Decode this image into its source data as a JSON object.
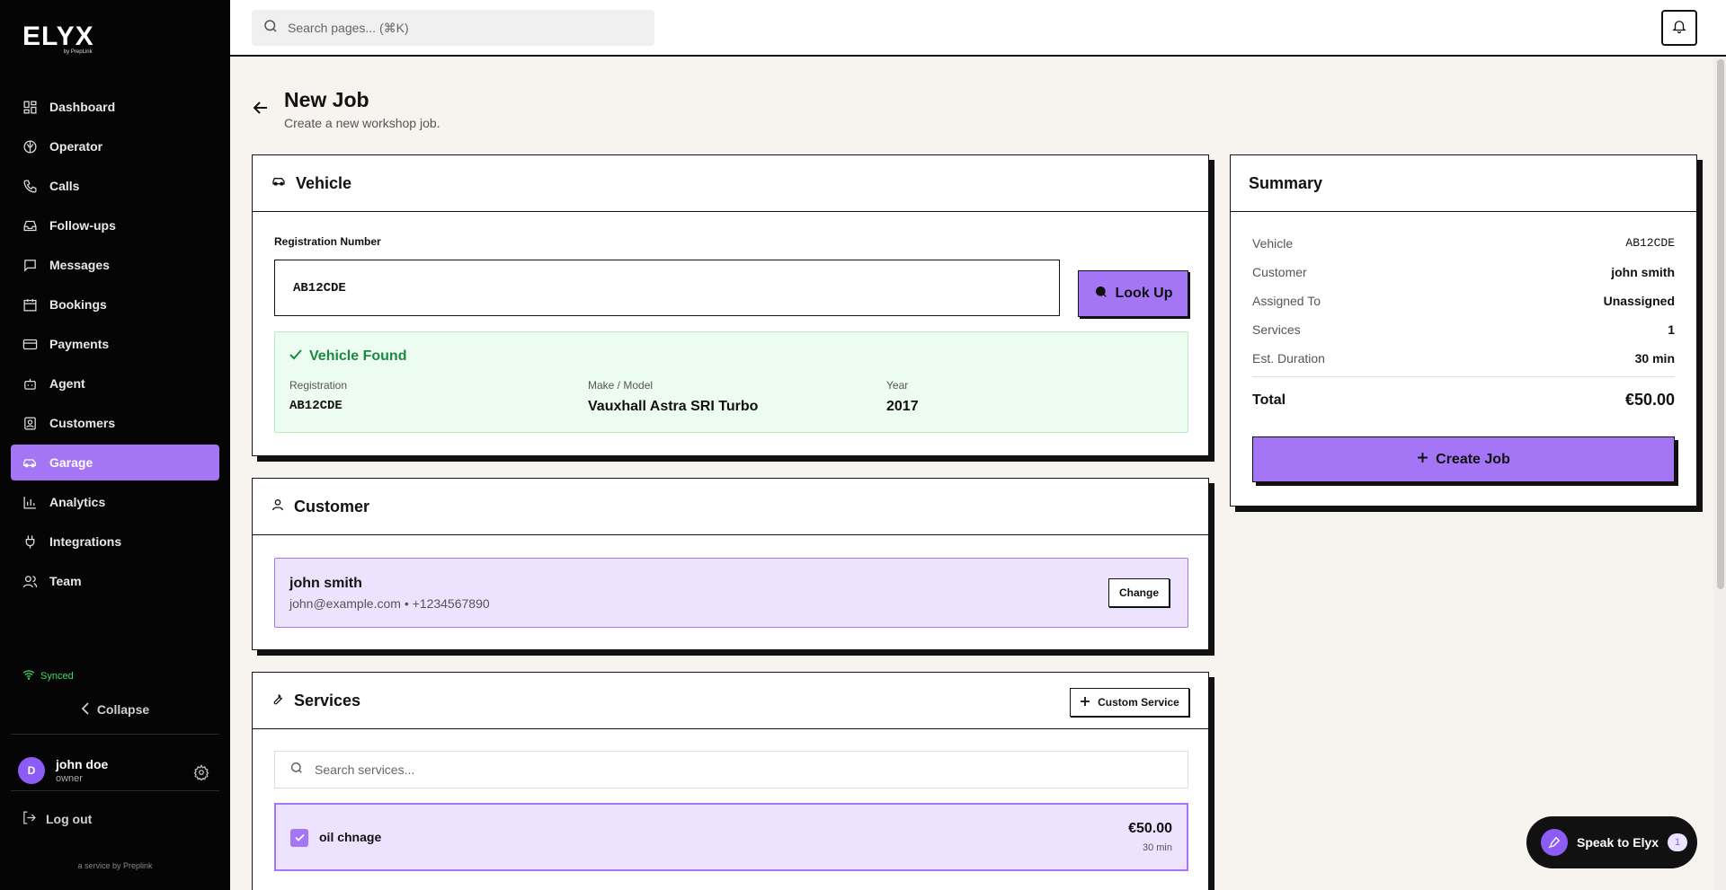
{
  "brand": {
    "name": "ELYX",
    "tagline": "by PrepLink"
  },
  "sidebar": {
    "items": [
      {
        "label": "Dashboard",
        "icon": "dashboard-icon"
      },
      {
        "label": "Operator",
        "icon": "brain-icon"
      },
      {
        "label": "Calls",
        "icon": "phone-icon"
      },
      {
        "label": "Follow-ups",
        "icon": "inbox-icon"
      },
      {
        "label": "Messages",
        "icon": "message-icon"
      },
      {
        "label": "Bookings",
        "icon": "calendar-icon"
      },
      {
        "label": "Payments",
        "icon": "credit-card-icon"
      },
      {
        "label": "Agent",
        "icon": "bot-icon"
      },
      {
        "label": "Customers",
        "icon": "contact-icon"
      },
      {
        "label": "Garage",
        "icon": "car-icon",
        "active": true
      },
      {
        "label": "Analytics",
        "icon": "bar-chart-icon"
      },
      {
        "label": "Integrations",
        "icon": "plug-icon"
      },
      {
        "label": "Team",
        "icon": "users-icon"
      }
    ],
    "status": "Synced",
    "collapse_label": "Collapse",
    "user": {
      "initial": "D",
      "name": "john doe",
      "role": "owner"
    },
    "logout_label": "Log out",
    "footer": "a service by Preplink"
  },
  "topbar": {
    "search_placeholder": "Search pages... (⌘K)"
  },
  "page": {
    "title": "New Job",
    "subtitle": "Create a new workshop job."
  },
  "vehicle": {
    "heading": "Vehicle",
    "reg_label": "Registration Number",
    "reg_value": "AB12CDE",
    "lookup_label": "Look Up",
    "found_title": "Vehicle Found",
    "registration_key": "Registration",
    "registration_value": "AB12CDE",
    "make_key": "Make / Model",
    "make_value": "Vauxhall Astra SRI Turbo",
    "year_key": "Year",
    "year_value": "2017"
  },
  "customer": {
    "heading": "Customer",
    "name": "john smith",
    "contact": "john@example.com • +1234567890",
    "change_label": "Change"
  },
  "services": {
    "heading": "Services",
    "custom_label": "Custom Service",
    "search_placeholder": "Search services...",
    "items": [
      {
        "name": "oil chnage",
        "price": "€50.00",
        "duration": "30 min",
        "checked": true
      }
    ]
  },
  "summary": {
    "heading": "Summary",
    "rows": [
      {
        "key": "Vehicle",
        "value": "AB12CDE"
      },
      {
        "key": "Customer",
        "value": "john smith"
      },
      {
        "key": "Assigned To",
        "value": "Unassigned"
      },
      {
        "key": "Services",
        "value": "1"
      },
      {
        "key": "Est. Duration",
        "value": "30 min"
      }
    ],
    "total_label": "Total",
    "total_value": "€50.00",
    "create_label": "Create Job"
  },
  "assistant": {
    "label": "Speak to Elyx",
    "badge": "1"
  },
  "colors": {
    "accent": "#a476f5",
    "success": "#1b8a40",
    "sidebar_bg": "#050505",
    "page_bg": "#f7f3ef"
  }
}
